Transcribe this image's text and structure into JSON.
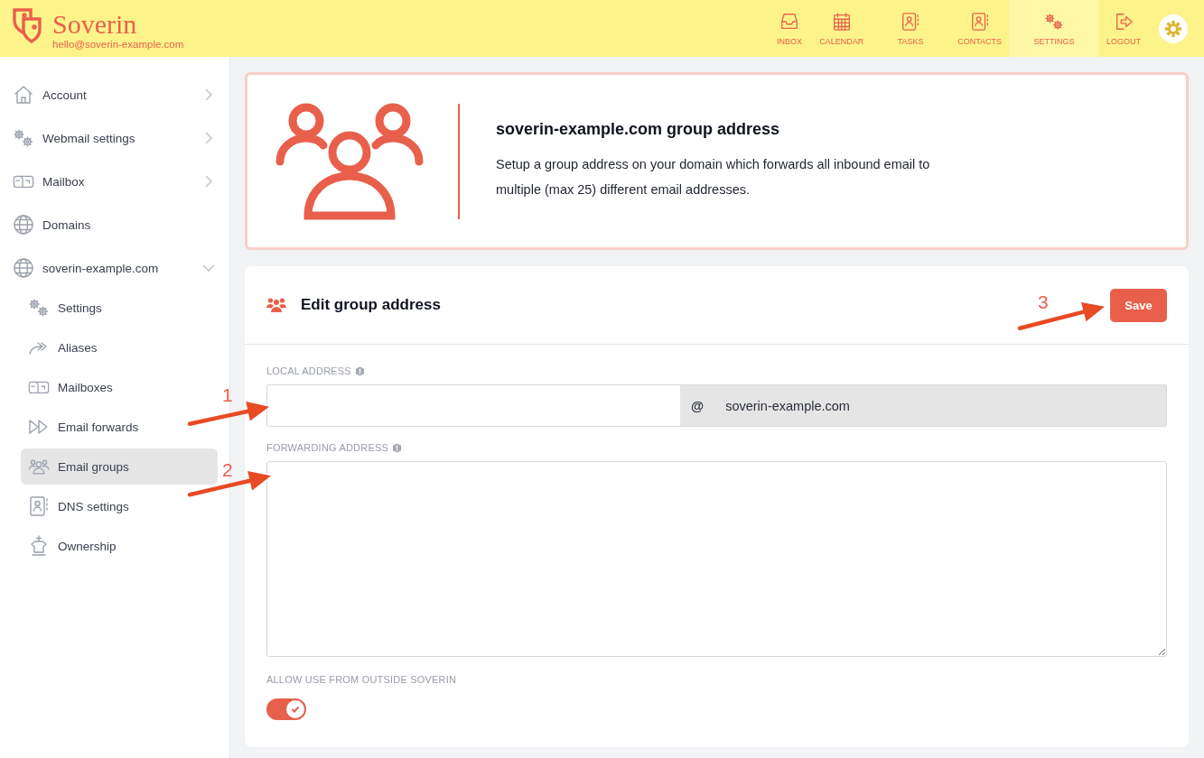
{
  "brand": {
    "name": "Soverin",
    "email": "hello@soverin-example.com"
  },
  "top_nav": [
    {
      "label": "INBOX",
      "selected": false
    },
    {
      "label": "CALENDAR",
      "selected": false
    },
    {
      "label": "TASKS",
      "selected": false
    },
    {
      "label": "CONTACTS",
      "selected": false
    },
    {
      "label": "SETTINGS",
      "selected": true
    },
    {
      "label": "LOGOUT",
      "selected": false
    }
  ],
  "sidebar": {
    "items": [
      {
        "kind": "group",
        "label": "Account",
        "expanded": false,
        "selected": false
      },
      {
        "kind": "group",
        "label": "Webmail settings",
        "expanded": false,
        "selected": false
      },
      {
        "kind": "group",
        "label": "Mailbox",
        "expanded": false,
        "selected": false
      },
      {
        "kind": "link",
        "label": "Domains",
        "selected": false
      },
      {
        "kind": "group",
        "label": "soverin-example.com",
        "expanded": true,
        "selected": false,
        "children": [
          {
            "label": "Settings",
            "selected": false
          },
          {
            "label": "Aliases",
            "selected": false
          },
          {
            "label": "Mailboxes",
            "selected": false
          },
          {
            "label": "Email forwards",
            "selected": false
          },
          {
            "label": "Email groups",
            "selected": true
          },
          {
            "label": "DNS settings",
            "selected": false
          },
          {
            "label": "Ownership",
            "selected": false
          }
        ]
      }
    ]
  },
  "banner": {
    "title": "soverin-example.com group address",
    "description": "Setup a group address on your domain which forwards all inbound email to multiple (max 25) different email addresses."
  },
  "form": {
    "title": "Edit group address",
    "save_button": "Save",
    "local_address": {
      "label": "LOCAL ADDRESS",
      "at_sign": "@",
      "domain": "soverin-example.com"
    },
    "forwarding_address": {
      "label": "FORWARDING ADDRESS"
    },
    "allow_outside": {
      "label": "ALLOW USE FROM OUTSIDE SOVERIN",
      "on": true
    }
  },
  "annotations": [
    {
      "label": "1"
    },
    {
      "label": "2"
    },
    {
      "label": "3"
    }
  ]
}
